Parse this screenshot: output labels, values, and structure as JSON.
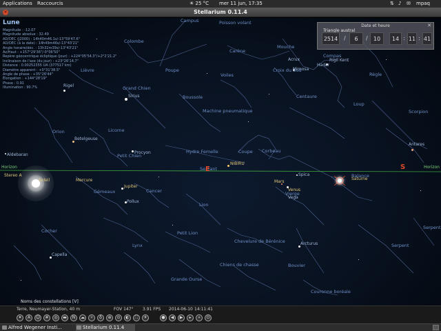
{
  "top_panel": {
    "applications": "Applications",
    "shortcuts": "Raccourcis",
    "weather": "25 °C",
    "clock": "mer 11 jun, 17:35",
    "user": "mpaq"
  },
  "window": {
    "title": "Stellarium 0.11.4"
  },
  "info": {
    "object_name": "Lune",
    "lines": [
      "Magnitude : -12.07",
      "Magnitude absolue : 32.49",
      "AD/DEC (J2000) : 14h40m46.1s/-13°59'47.6\"",
      "AD/DEC (à la date) : 14h49m46s/-13°43'21\"",
      "Angle horaire/déc. : 13h32m39s/-13°43'21\"",
      "Az/Haut : +157°29'36\"/-0°06'50\"",
      "Repère géocentrique écliptique (jour) : +224°05'54.3\"/+2°2'21.2\"",
      "Inclinaison de l'axe (du jour) : +23°26'14.7\"",
      "Distance : 0.00252355 UA (377517 km)",
      "Diamètre apparent : +0°31'38.5\"",
      "Angle de phase : +35°26'44\"",
      "Élongation : +144°28'19\"",
      "Phase : 0.91",
      "Illumination : 90.7%"
    ]
  },
  "datetime": {
    "header": "Date et heure",
    "year": "2514",
    "month": "6",
    "day": "10",
    "hour": "14",
    "minute": "11",
    "second": "41",
    "tooltip": "Triangle austral"
  },
  "sky": {
    "constellations": {
      "campus": "Campus",
      "poisson_volant": "Poisson volant",
      "colombe": "Colombe",
      "carene": "Carène",
      "mouche": "Mouche",
      "compas": "Compas",
      "lievre": "Lièvre",
      "poupe": "Poupe",
      "croix_du_sud": "Croix du Sud",
      "voiles": "Voiles",
      "regle": "Règle",
      "grand_chien": "Grand Chien",
      "boussole": "Boussole",
      "centaure": "Centaure",
      "machine_pneumatique": "Machine pneumatique",
      "loup": "Loup",
      "scorpion": "Scorpion",
      "orion": "Orion",
      "licorne": "Licorne",
      "hydre_femelle": "Hydre Femelle",
      "coupe": "Coupe",
      "corbeau": "Corbeau",
      "petit_chien": "Petit Chien",
      "sextant": "Sextant",
      "gemeaux": "Gémeaux",
      "cancer": "Cancer",
      "vierge": "Vierge",
      "balance": "Balance",
      "lion": "Lion",
      "cocher": "Cocher",
      "petit_lion": "Petit Lion",
      "chevelure": "Chevelure de Bérénice",
      "lynx": "Lynx",
      "chiens_de_chasse": "Chiens de chasse",
      "serpent": "Serpent",
      "serpent2": "Serpent",
      "bouvier": "Bouvier",
      "grande_ourse": "Grande Ourse",
      "couronne_boreale": "Couronne boréale"
    },
    "stars": {
      "acrux": "Acrux",
      "mimosa": "Mimosa",
      "hadar": "Hadar",
      "rigil_kent": "Rigil Kent",
      "rigel": "Rigel",
      "sirius": "Sirius",
      "betelgeuse": "Betelgeuse",
      "procyon": "Procyon",
      "aldebaran": "Aldebaran",
      "pollux": "Pollux",
      "capella": "Capella",
      "spica": "Spica",
      "arcturus": "Arcturus",
      "antares": "Antares",
      "vega": "Vega",
      "nibiru": "NIBIRU"
    },
    "planets": {
      "soleil": "Soleil",
      "mercure": "Mercure",
      "jupiter": "Jupiter",
      "venus": "Venus",
      "mars": "Mars",
      "saturne": "Saturne",
      "stereo_a": "Stereo A"
    },
    "horizon_left": "Horizon",
    "horizon_right": "Horizon",
    "cardinal_e": "E",
    "cardinal_s": "S"
  },
  "bottom_bar": {
    "tooltip": "Noms des constellations  [V]",
    "location": "Terre, Neumayer-Station, 40 m",
    "fov": "FOV 147°",
    "fps": "3.91 FPS",
    "date": "2014-06-10",
    "time": "14:11:41"
  },
  "taskbar": {
    "task1": "Alfred Wegener Insti...",
    "task2": "Stellarium 0.11.4"
  },
  "colors": {
    "constellation_line": "#5a73a6",
    "horizon": "#3fa63f",
    "cardinal": "#e04a2a"
  }
}
